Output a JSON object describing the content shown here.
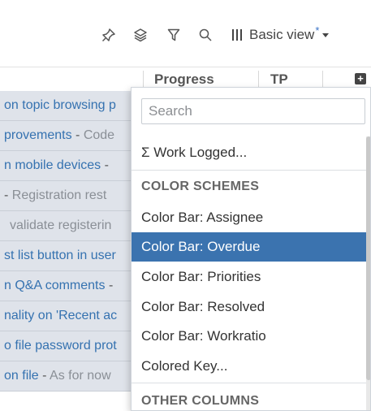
{
  "toolbar": {
    "icons": [
      "pin-icon",
      "layers-icon",
      "filter-icon",
      "search-icon"
    ],
    "view_label": "Basic view",
    "view_modified_marker": "*"
  },
  "columns": {
    "progress": "Progress",
    "tp": "TP"
  },
  "rows": [
    {
      "title": "on topic browsing p",
      "sep": "",
      "summary": ""
    },
    {
      "title": "provements",
      "sep": " - ",
      "summary": "Code"
    },
    {
      "title": "n mobile devices",
      "sep": " - ",
      "summary": ""
    },
    {
      "title": "",
      "sep": "- ",
      "summary": "Registration rest"
    },
    {
      "title": "",
      "sep": "",
      "summary": "validate registerin"
    },
    {
      "title": "st list button in user",
      "sep": "",
      "summary": ""
    },
    {
      "title": "n Q&A comments",
      "sep": " - ",
      "summary": ""
    },
    {
      "title": "nality on 'Recent ac",
      "sep": "",
      "summary": ""
    },
    {
      "title": "o file password prot",
      "sep": "",
      "summary": ""
    },
    {
      "title": "on file",
      "sep": " - ",
      "summary": "As for now"
    }
  ],
  "dropdown": {
    "search_placeholder": "Search",
    "work_logged": "Σ Work Logged...",
    "color_schemes_heading": "COLOR SCHEMES",
    "items": [
      "Color Bar: Assignee",
      "Color Bar: Overdue",
      "Color Bar: Priorities",
      "Color Bar: Resolved",
      "Color Bar: Workratio",
      "Colored Key..."
    ],
    "selected_item": "Color Bar: Overdue",
    "other_columns_heading": "OTHER COLUMNS"
  },
  "colors": {
    "accent": "#3b73af",
    "link": "#3572b0",
    "row_bg": "#dfe3ea"
  }
}
